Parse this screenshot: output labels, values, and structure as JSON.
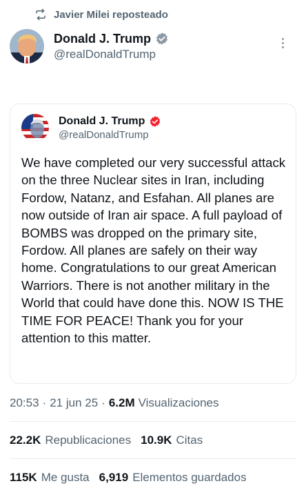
{
  "repost": {
    "icon": "repost-icon",
    "text": "Javier Milei reposteado"
  },
  "post": {
    "author_name": "Donald J. Trump",
    "author_handle": "@realDonaldTrump",
    "verified_badge": "gray-verified-badge-icon",
    "more_icon": "more-options-icon"
  },
  "quote": {
    "author_name": "Donald J. Trump",
    "author_handle": "@realDonaldTrump",
    "verified_badge": "red-verified-badge-icon",
    "body": "We have completed our very successful attack on the three Nuclear sites in Iran, including Fordow, Natanz, and Esfahan. All planes are now outside of Iran air space. A full payload of BOMBS was dropped on the primary site, Fordow. All planes are safely on their way home. Congratulations to our great American Warriors. There is not another military in the World that could have done this. NOW IS THE TIME FOR PEACE! Thank you for your attention to this matter."
  },
  "meta": {
    "time": "20:53",
    "separator": "·",
    "date": "21 jun 25",
    "views_count": "6.2M",
    "views_label": "Visualizaciones"
  },
  "stats": {
    "reposts_count": "22.2K",
    "reposts_label": "Republicaciones",
    "quotes_count": "10.9K",
    "quotes_label": "Citas",
    "likes_count": "115K",
    "likes_label": "Me gusta",
    "bookmarks_count": "6,919",
    "bookmarks_label": "Elementos guardados"
  },
  "colors": {
    "text_primary": "#0f1419",
    "text_secondary": "#536471",
    "border": "#e6ecf0",
    "badge_gray": "#8b98a5",
    "badge_red": "#f4212e"
  }
}
